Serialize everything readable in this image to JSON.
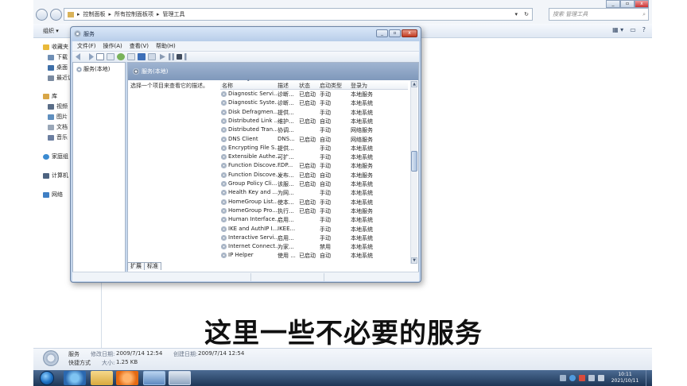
{
  "explorer": {
    "breadcrumb": [
      "控制面板",
      "所有控制面板项",
      "管理工具"
    ],
    "search_placeholder": "搜索 管理工具",
    "organize_label": "组织 ▾",
    "nav": [
      {
        "label": "收藏夹",
        "color": "#e9b93a"
      },
      {
        "label": "下载",
        "color": "#6f8fb5"
      },
      {
        "label": "桌面",
        "color": "#3e6fa8"
      },
      {
        "label": "最近访",
        "color": "#7a8aa0"
      },
      {
        "label": "库",
        "color": "#d8a648"
      },
      {
        "label": "视频",
        "color": "#5a6d87"
      },
      {
        "label": "图片",
        "color": "#5f8fbf"
      },
      {
        "label": "文档",
        "color": "#9aa7b8"
      },
      {
        "label": "音乐",
        "color": "#6b7ea0"
      },
      {
        "label": "家庭组",
        "color": "#3b8bd1"
      },
      {
        "label": "计算机",
        "color": "#4d6380"
      },
      {
        "label": "网络",
        "color": "#3f7fc4"
      }
    ],
    "details": {
      "name": "服务",
      "type": "快捷方式",
      "modified_label": "修改日期:",
      "modified": "2009/7/14 12:54",
      "created_label": "创建日期:",
      "created": "2009/7/14 12:54",
      "size_label": "大小:",
      "size": "1.25 KB"
    }
  },
  "services_window": {
    "title": "服务",
    "menu": [
      "文件(F)",
      "操作(A)",
      "查看(V)",
      "帮助(H)"
    ],
    "tree_root": "服务(本地)",
    "pane_title": "服务(本地)",
    "description_prompt": "选择一个项目来查看它的描述。",
    "columns": [
      "名称",
      "描述",
      "状态",
      "启动类型",
      "登录为"
    ],
    "rows": [
      [
        "Diagnostic Servi...",
        "诊断...",
        "已启动",
        "手动",
        "本地服务"
      ],
      [
        "Diagnostic Syste...",
        "诊断...",
        "已启动",
        "手动",
        "本地系统"
      ],
      [
        "Disk Defragmen...",
        "提供...",
        "",
        "手动",
        "本地系统"
      ],
      [
        "Distributed Link ...",
        "维护...",
        "已启动",
        "自动",
        "本地系统"
      ],
      [
        "Distributed Tran...",
        "协调...",
        "",
        "手动",
        "网络服务"
      ],
      [
        "DNS Client",
        "DNS...",
        "已启动",
        "自动",
        "网络服务"
      ],
      [
        "Encrypting File S...",
        "提供...",
        "",
        "手动",
        "本地系统"
      ],
      [
        "Extensible Authe...",
        "可扩...",
        "",
        "手动",
        "本地系统"
      ],
      [
        "Function Discove...",
        "FDP...",
        "已启动",
        "手动",
        "本地服务"
      ],
      [
        "Function Discove...",
        "发布...",
        "已启动",
        "自动",
        "本地服务"
      ],
      [
        "Group Policy Cli...",
        "该服...",
        "已启动",
        "自动",
        "本地系统"
      ],
      [
        "Health Key and ...",
        "为网...",
        "",
        "手动",
        "本地系统"
      ],
      [
        "HomeGroup List...",
        "使本...",
        "已启动",
        "手动",
        "本地系统"
      ],
      [
        "HomeGroup Pro...",
        "执行...",
        "已启动",
        "手动",
        "本地服务"
      ],
      [
        "Human Interface...",
        "启用...",
        "",
        "手动",
        "本地系统"
      ],
      [
        "IKE and AuthIP I...",
        "IKEE...",
        "",
        "手动",
        "本地系统"
      ],
      [
        "Interactive Servi...",
        "启用...",
        "",
        "手动",
        "本地系统"
      ],
      [
        "Internet Connect...",
        "为家...",
        "",
        "禁用",
        "本地系统"
      ],
      [
        "IP Helper",
        "使用 ...",
        "已启动",
        "自动",
        "本地系统"
      ]
    ],
    "tabs": [
      "扩展",
      "标准"
    ]
  },
  "taskbar": {
    "time": "10:11",
    "date": "2021/10/11"
  },
  "subtitle": "这里一些不必要的服务"
}
